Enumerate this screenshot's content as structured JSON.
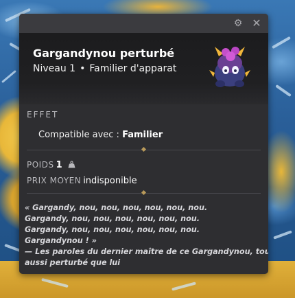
{
  "window": {
    "settings_icon": "gear-icon",
    "close_icon": "close-icon"
  },
  "item": {
    "name": "Gargandynou perturbé",
    "level": "Niveau 1",
    "separator": "•",
    "type": "Familier d'apparat",
    "image_icon": "creature-portrait"
  },
  "effect": {
    "label": "EFFET",
    "compat_prefix": "Compatible avec :",
    "compat_value": "Familier"
  },
  "stats": {
    "weight_label": "POIDS",
    "weight_value": "1",
    "weight_icon": "weight-icon",
    "price_label": "PRIX MOYEN",
    "price_value": "indisponible"
  },
  "lore": {
    "lines": [
      "« Gargandy, nou, nou, nou, nou, nou, nou.",
      "Gargandy, nou, nou, nou, nou, nou, nou.",
      "Gargandy, nou, nou, nou, nou, nou, nou.",
      "Gargandynou ! »",
      "— Les paroles du dernier maître de ce Gargandynou, tout",
      "aussi perturbé que lui"
    ]
  },
  "colors": {
    "panel_bg": "#2e2e31",
    "titlebar_bg": "#3b3b3f",
    "header_bg": "#1c1c1e",
    "divider_gem": "#b99a5a"
  }
}
